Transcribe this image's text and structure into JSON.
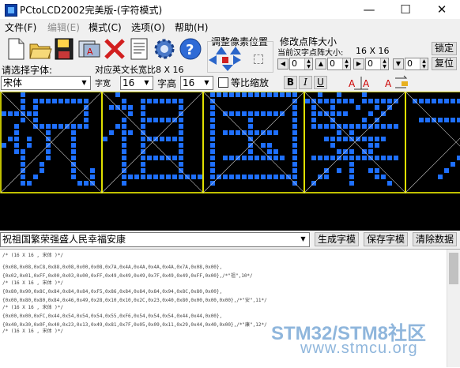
{
  "window": {
    "title": "PCtoLCD2002完美版-(字符模式)"
  },
  "menu": {
    "items": [
      "文件(F)",
      "编辑(E)",
      "模式(C)",
      "选项(O)",
      "帮助(H)"
    ]
  },
  "toolbar": {
    "icons": [
      "new-icon",
      "open-icon",
      "save-icon",
      "font-icon",
      "delete-icon",
      "document-icon",
      "settings-gear-icon",
      "help-icon"
    ],
    "pixel_group_label": "调整像素位置",
    "size_group_label": "修改点阵大小",
    "size_sub_label": "当前汉字点阵大小:",
    "size_value": "16 X 16",
    "confirm_label": "锁定",
    "reset_label": "复位",
    "spin_values": [
      "0",
      "0",
      "0",
      "0"
    ]
  },
  "font_row": {
    "font_label": "请选择字体:",
    "font_value": "宋体",
    "ascii_label": "对应英文长宽比8 X 16",
    "width_label": "字宽",
    "width_value": "16",
    "height_label": "字高",
    "height_value": "16",
    "proportional_label": "等比缩放",
    "bold": "B",
    "italic": "I",
    "underline": "U"
  },
  "canvas": {
    "bg": "#000000",
    "pixel_color": "#1e6fff",
    "border_color": "#ffff00",
    "chars": 5
  },
  "input": {
    "text": "祝祖国繁荣强盛人民幸福安康",
    "generate_label": "生成字模",
    "save_label": "保存字模",
    "clear_label": "清除数据"
  },
  "output_lines": [
    "/* (16 X 16 , 宋体 )*/",
    "",
    "{0x08,0x08,0xC8,0x88,0x08,0x00,0x08,0x7A,0x4A,0x4A,0x4A,0x4A,0x7A,0x08,0x00},",
    "{0x02,0x01,0xFF,0x00,0x03,0x00,0xFF,0x49,0x49,0x49,0x7F,0x49,0x49,0xFF,0x00},/*\"祖\",10*/",
    "/* (16 X 16 , 宋体 )*/",
    "",
    "{0x80,0x90,0x8C,0x84,0x84,0x84,0xF5,0x86,0x84,0x84,0x84,0x94,0x8C,0x80,0x00},",
    "{0x00,0x80,0x80,0x84,0x46,0x49,0x28,0x10,0x10,0x2C,0x23,0x40,0x80,0x00,0x00,0x00},/*\"安\",11*/",
    "/* (16 X 16 , 宋体 )*/",
    "",
    "{0x00,0x00,0xFC,0x44,0x54,0x54,0x54,0x55,0xF6,0x54,0x54,0x54,0x44,0x44,0x00},",
    "{0x40,0x30,0x0F,0x40,0x23,0x13,0x49,0x81,0x7F,0x05,0x09,0x11,0x29,0x44,0x40,0x00},/*\"康\",12*/",
    "/* (16 X 16 , 宋体 )*/"
  ],
  "watermark": {
    "line1": "STM32/STM8社区",
    "line2": "www.stmcu.org"
  }
}
